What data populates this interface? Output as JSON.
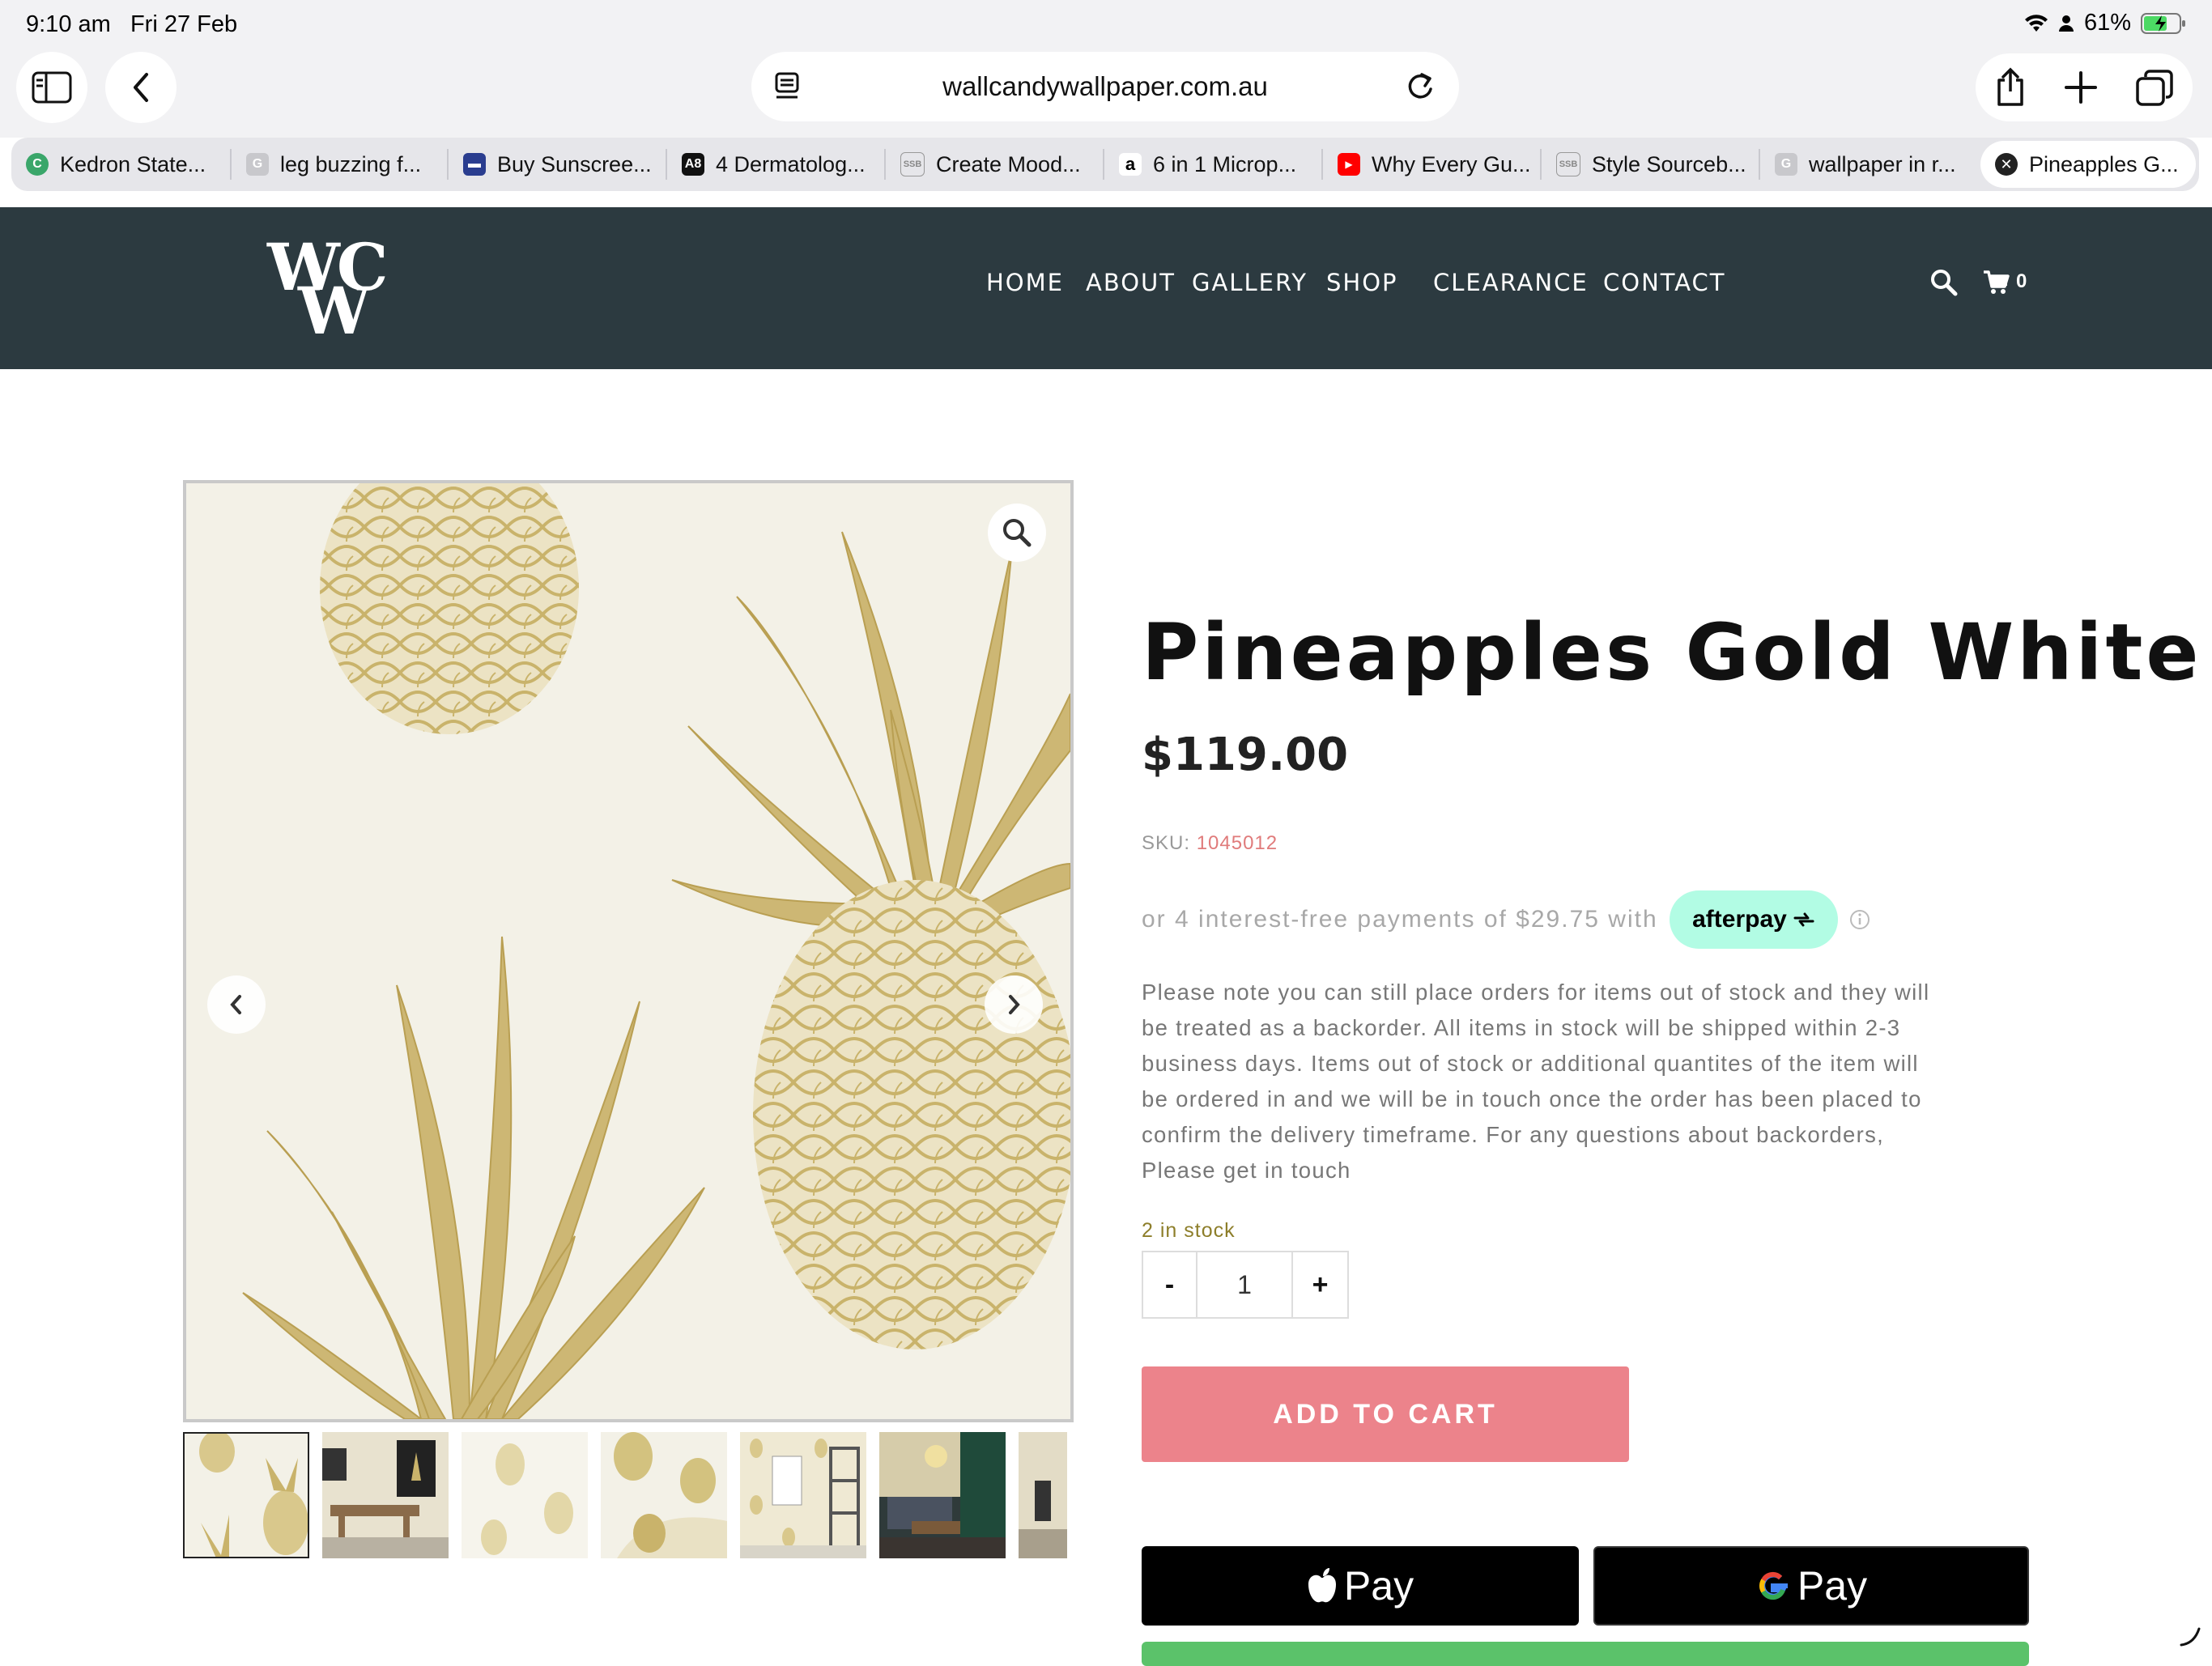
{
  "status_bar": {
    "time": "9:10 am",
    "date": "Fri 27 Feb",
    "battery": "61%"
  },
  "browser": {
    "url": "wallcandywallpaper.com.au",
    "tabs": [
      {
        "label": "Kedron State...",
        "icon": "green-c-favicon",
        "color": "#3aa66a"
      },
      {
        "label": "leg buzzing f...",
        "icon": "google-favicon",
        "color": "#c8c8cc"
      },
      {
        "label": "Buy Sunscree...",
        "icon": "store-favicon",
        "color": "#2a3d8f"
      },
      {
        "label": "4 Dermatolog...",
        "icon": "a8-favicon",
        "color": "#111111"
      },
      {
        "label": "Create Mood...",
        "icon": "ssb-favicon",
        "color": "#999999"
      },
      {
        "label": "6 in 1 Microp...",
        "icon": "amazon-favicon",
        "color": "#ffffff"
      },
      {
        "label": "Why Every Gu...",
        "icon": "youtube-favicon",
        "color": "#ff0000"
      },
      {
        "label": "Style Sourceb...",
        "icon": "ssb-favicon",
        "color": "#999999"
      },
      {
        "label": "wallpaper in r...",
        "icon": "google-favicon",
        "color": "#c8c8cc"
      },
      {
        "label": "Pineapples G...",
        "icon": "close-icon",
        "color": "#222222"
      }
    ]
  },
  "site": {
    "logo_line1": "WC",
    "logo_line2": "W",
    "nav": [
      "HOME",
      "ABOUT",
      "GALLERY",
      "SHOP",
      "CLEARANCE",
      "CONTACT"
    ],
    "cart_count": "0",
    "header_color": "#2c3a40"
  },
  "product": {
    "title": "Pineapples Gold White",
    "price": "$119.00",
    "sku_label": "SKU:",
    "sku": "1045012",
    "afterpay_text": "or 4 interest-free payments of $29.75 with",
    "afterpay_logo": "afterpay",
    "notice": "Please note you can still place orders for items out of stock and they will be treated as a backorder. All items in stock will be shipped within 2-3 business days. Items out of stock or additional quantites of the item will be ordered in and we will be in touch once the order has been placed to confirm the delivery timeframe. For any questions about backorders, Please get in touch",
    "stock": "2 in stock",
    "qty_minus": "-",
    "qty_value": "1",
    "qty_plus": "+",
    "add_to_cart": "ADD TO CART",
    "apple_pay": "Pay",
    "google_pay": "Pay",
    "accent_color": "#ec838b",
    "gold": "#c9b36b"
  }
}
